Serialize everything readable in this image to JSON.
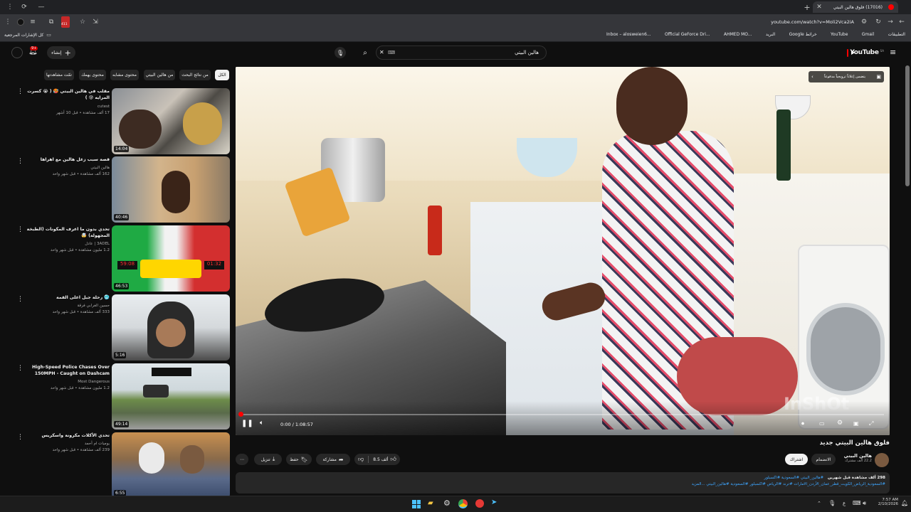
{
  "browser": {
    "tab_title": "(17016) فلوق هالين البيتي",
    "url": "youtube.com/watch?v=Moli2Vca2iA",
    "badge_count": "411",
    "bookmarks_all": "كل الإشارات المرجعية",
    "bookmarks": [
      "Inbox – alosweien6...",
      "Official GeForce Dri...",
      "AHMED MO...",
      "البريد",
      "Google خرائط",
      "YouTube",
      "Gmail",
      "التطبيقات"
    ]
  },
  "header": {
    "logo_text": "YouTube",
    "logo_region": "SA",
    "search_value": "هالين البيتي",
    "create_label": "إنشاء",
    "notif_count": "9+"
  },
  "chips": [
    "الكل",
    "من نتائج البحث",
    "من هالين البيتي",
    "محتوى مشابه",
    "محتوى يهمك",
    "تمّت مشاهدتها"
  ],
  "sidebar_videos": [
    {
      "title": "مقلب في هالين البيتي 🥵 ( 😭 كسرت المرايه 😰 )",
      "channel": "cutest",
      "meta": "17 ألف مشاهدة • قبل 10 أشهر",
      "duration": "14:04"
    },
    {
      "title": "قصة سبب زعل هالين مع اهراها",
      "channel": "هالين البيتي",
      "meta": "162 ألف مشاهدة • قبل شهر واحد",
      "duration": "40:46"
    },
    {
      "title": "تحدي بدون ما اعرف المكونات (الطبخة المجهولة) 🤯",
      "channel": "3ADEL | عادل",
      "meta": "1.2 مليون مشاهدة • قبل شهر واحد",
      "duration": "46:53"
    },
    {
      "title": "🥶 رحلة جبل اعلى القمة",
      "channel": "حسين الغرابي فرقة",
      "meta": "333 ألف مشاهدة • قبل شهر واحد",
      "duration": "5:16"
    },
    {
      "title": "High-Speed Police Chases Over 150MPH - Caught on Dashcam",
      "channel": "Most Dangerous",
      "meta": "1.2 مليون مشاهدة • قبل شهر واحد",
      "duration": "49:14"
    },
    {
      "title": "تحدي الأكلات مكرونة واسكريس",
      "channel": "يوميات ام أحمد",
      "meta": "239 ألف مشاهدة • قبل شهر واحد",
      "duration": "6:55"
    }
  ],
  "player": {
    "time_current": "0:00",
    "time_total": "1:08:57",
    "progress": 0.0,
    "popup_text": "يتضمن إعلاناً ترويجياً مدفوعاً",
    "watermark": "InShOt"
  },
  "video": {
    "title": "فلوق هالين البيتي جديد",
    "channel_name": "هالين البيتي",
    "subscribers": "22.2 ألف مشترك",
    "join_label": "الانضمام",
    "subscribe_label": "اشتراك",
    "likes": "8.5 ألف",
    "share_label": "مشاركة",
    "save_label": "حفظ",
    "download_label": "تنزيل",
    "views_line": "298 ألف مشاهدة قبل شهرين",
    "hashtags_line": "#هالين_البيتي #السعودية #اكسبلور",
    "description": "#السعودية_الرياض_الكويت_قطر_عمان_الأردن_الامارات #ترند #الرياض #اكسبلور #السعودية #هالين_البيتي ...المزيد"
  },
  "taskbar": {
    "time": "7:57 AM",
    "date": "2/10/2026",
    "lang": "ع"
  }
}
